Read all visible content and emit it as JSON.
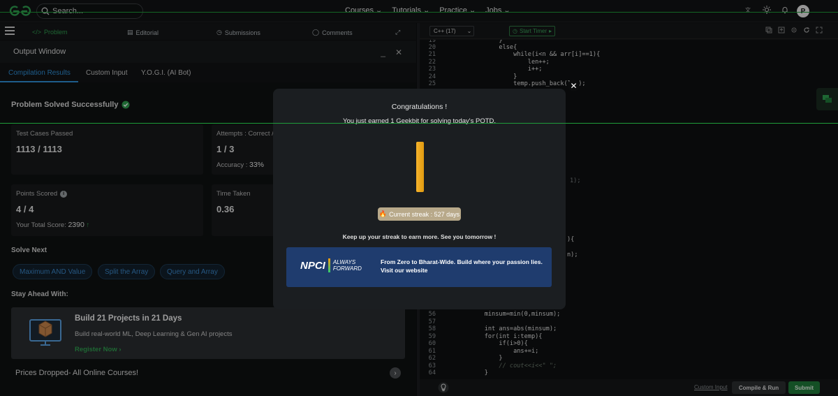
{
  "topnav": {
    "search_placeholder": "Search...",
    "links": [
      "Courses",
      "Tutorials",
      "Practice",
      "Jobs"
    ],
    "avatar_initial": "P"
  },
  "left_tabs": {
    "problem": "Problem",
    "editorial": "Editorial",
    "submissions": "Submissions",
    "comments": "Comments"
  },
  "output": {
    "title": "Output Window",
    "tabs": [
      "Compilation Results",
      "Custom Input",
      "Y.O.G.I. (AI Bot)"
    ],
    "status": "Problem Solved Successfully",
    "test_cases_label": "Test Cases Passed",
    "test_cases_value": "1113 / 1113",
    "attempts_label": "Attempts : Correct /",
    "attempts_value": "1 / 3",
    "accuracy_label": "Accuracy :",
    "accuracy_value": "33%",
    "points_label": "Points Scored",
    "points_value": "4 / 4",
    "total_score_label": "Your Total Score:",
    "total_score_value": "2390",
    "time_label": "Time Taken",
    "time_value": "0.36",
    "solve_next": "Solve Next",
    "suggestions": [
      "Maximum AND Value",
      "Split the Array",
      "Query and Array"
    ],
    "stay_ahead": "Stay Ahead With:",
    "promo_title": "Build 21 Projects in 21 Days",
    "promo_sub": "Build real-world ML, Deep Learning & Gen AI projects",
    "promo_link": "Register Now",
    "prices": "Prices Dropped- All Online Courses!"
  },
  "editor": {
    "language": "C++ (17)",
    "timer": "Start Timer",
    "custom_input": "Custom Input",
    "compile": "Compile & Run",
    "submit": "Submit",
    "lines": [
      {
        "n": "19",
        "t": "        }"
      },
      {
        "n": "20",
        "t": "        else{"
      },
      {
        "n": "21",
        "t": "            while(i<n && arr[i]==1){"
      },
      {
        "n": "22",
        "t": "                len++;"
      },
      {
        "n": "23",
        "t": "                i++;"
      },
      {
        "n": "24",
        "t": "            }"
      },
      {
        "n": "25",
        "t": "            temp.push_back(len);"
      },
      {
        "n": "56",
        "t": "    minsum=min(0,minsum);"
      },
      {
        "n": "57",
        "t": ""
      },
      {
        "n": "58",
        "t": "    int ans=abs(minsum);"
      },
      {
        "n": "59",
        "t": "    for(int i:temp){"
      },
      {
        "n": "60",
        "t": "        if(i>0){"
      },
      {
        "n": "61",
        "t": "            ans+=i;"
      },
      {
        "n": "62",
        "t": "        }"
      },
      {
        "n": "63",
        "t": "        // cout<<i<<\" \";"
      },
      {
        "n": "64",
        "t": "    }"
      }
    ],
    "fragments": [
      "1);",
      "){",
      "n);"
    ]
  },
  "modal": {
    "title": "Congratulations !",
    "earned": "You just earned 1 Geekbit for solving today's POTD.",
    "streak": "Current streak : 527 days",
    "keepup": "Keep up your streak to earn more. See you tomorrow !",
    "banner_logo": "NPCI",
    "banner_tag1": "ALWAYS",
    "banner_tag2": "FORWARD",
    "banner_text": "From Zero to Bharat-Wide. Build where your passion lies. Visit our website"
  }
}
